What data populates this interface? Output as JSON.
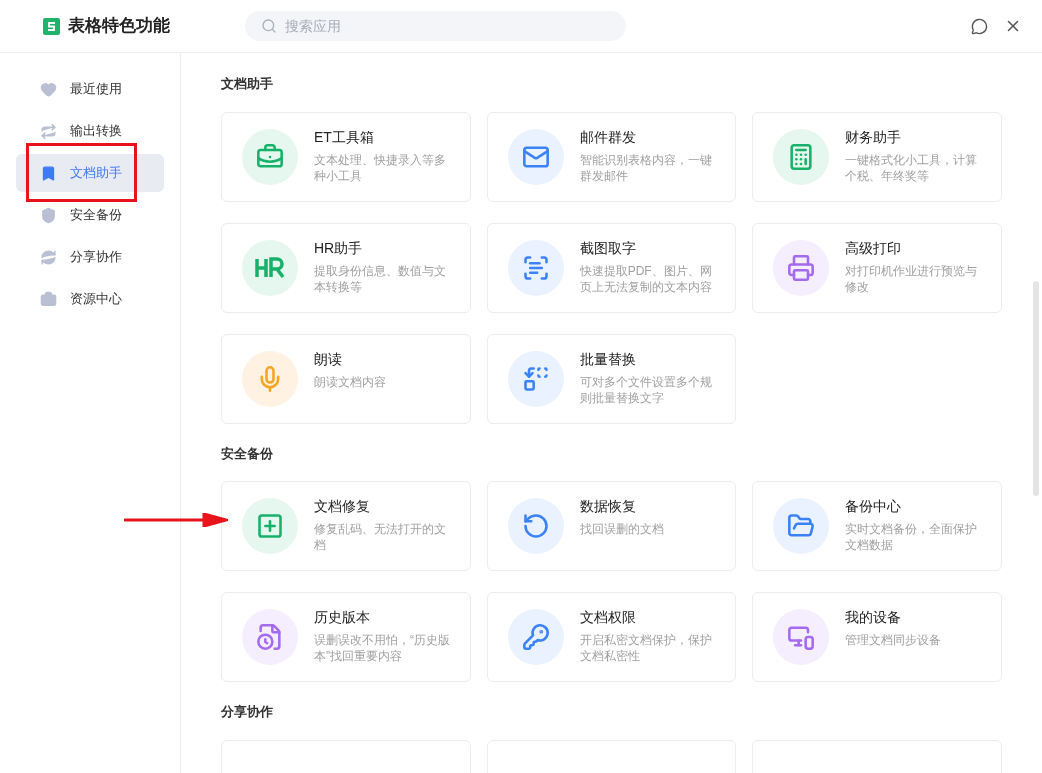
{
  "window": {
    "title": "表格特色功能"
  },
  "search": {
    "placeholder": "搜索应用"
  },
  "sidebar": {
    "items": [
      {
        "label": "最近使用",
        "selected": false
      },
      {
        "label": "输出转换",
        "selected": false
      },
      {
        "label": "文档助手",
        "selected": true
      },
      {
        "label": "安全备份",
        "selected": false
      },
      {
        "label": "分享协作",
        "selected": false
      },
      {
        "label": "资源中心",
        "selected": false
      }
    ]
  },
  "sections": [
    {
      "title": "文档助手",
      "items": [
        {
          "name": "ET工具箱",
          "description": "文本处理、快捷录入等多种小工具"
        },
        {
          "name": "邮件群发",
          "description": "智能识别表格内容，一键群发邮件"
        },
        {
          "name": "财务助手",
          "description": "一键格式化小工具，计算个税、年终奖等"
        },
        {
          "name": "HR助手",
          "description": "提取身份信息、数值与文本转换等"
        },
        {
          "name": "截图取字",
          "description": "快速提取PDF、图片、网页上无法复制的文本内容"
        },
        {
          "name": "高级打印",
          "description": "对打印机作业进行预览与修改"
        },
        {
          "name": "朗读",
          "description": "朗读文档内容"
        },
        {
          "name": "批量替换",
          "description": "可对多个文件设置多个规则批量替换文字"
        }
      ]
    },
    {
      "title": "安全备份",
      "items": [
        {
          "name": "文档修复",
          "description": "修复乱码、无法打开的文档"
        },
        {
          "name": "数据恢复",
          "description": "找回误删的文档"
        },
        {
          "name": "备份中心",
          "description": "实时文档备份，全面保护文档数据"
        },
        {
          "name": "历史版本",
          "description": "误删误改不用怕，“历史版本”找回重要内容"
        },
        {
          "name": "文档权限",
          "description": "开启私密文档保护，保护文档私密性"
        },
        {
          "name": "我的设备",
          "description": "管理文档同步设备"
        }
      ]
    },
    {
      "title": "分享协作"
    }
  ]
}
